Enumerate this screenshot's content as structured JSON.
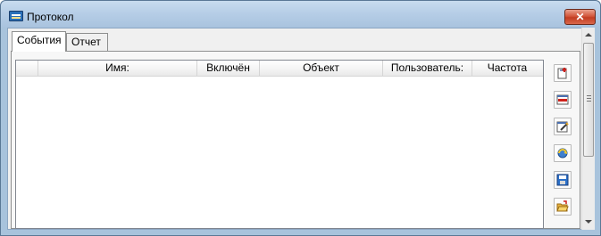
{
  "window": {
    "title": "Протокол",
    "close_label": "✕"
  },
  "tabs": [
    {
      "label": "События",
      "active": true
    },
    {
      "label": "Отчет",
      "active": false
    }
  ],
  "grid": {
    "columns": [
      "",
      "Имя:",
      "Включён",
      "Объект",
      "Пользователь:",
      "Частота"
    ],
    "rows": []
  },
  "toolbar": {
    "buttons": [
      {
        "icon": "add-icon"
      },
      {
        "icon": "delete-icon"
      },
      {
        "icon": "edit-icon"
      },
      {
        "icon": "refresh-icon"
      },
      {
        "icon": "save-icon"
      },
      {
        "icon": "open-folder-icon"
      }
    ]
  },
  "colors": {
    "titlebar": "#b5cde6",
    "close_button": "#c23d22",
    "frame": "#a8c3dc"
  }
}
